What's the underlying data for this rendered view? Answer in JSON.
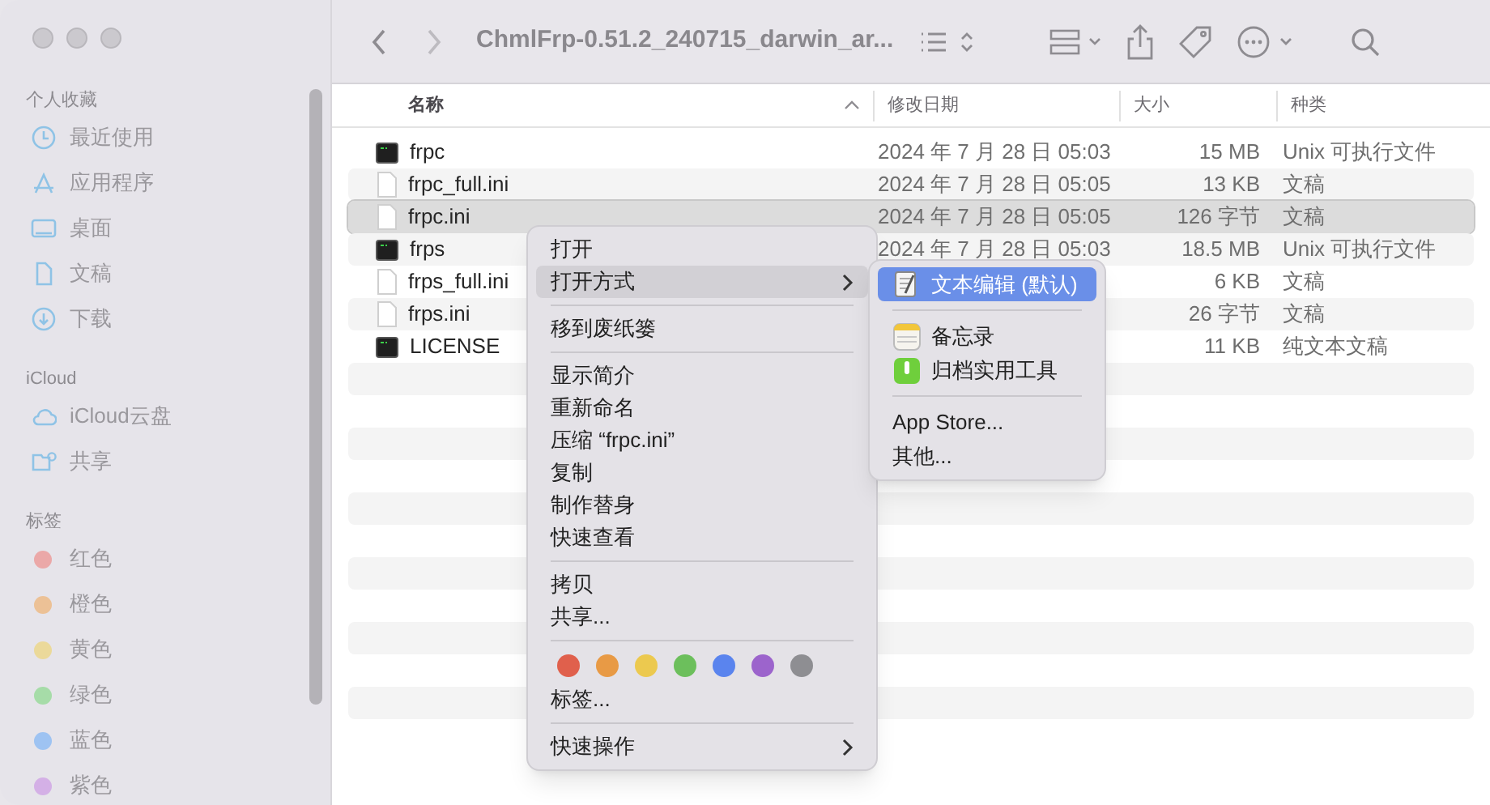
{
  "window": {
    "title": "ChmlFrp-0.51.2_240715_darwin_ar..."
  },
  "sidebar": {
    "sections": [
      {
        "heading": "个人收藏",
        "items": [
          {
            "label": "最近使用",
            "kind": "clock"
          },
          {
            "label": "应用程序",
            "kind": "apps"
          },
          {
            "label": "桌面",
            "kind": "desktop"
          },
          {
            "label": "文稿",
            "kind": "doc"
          },
          {
            "label": "下载",
            "kind": "download"
          }
        ]
      },
      {
        "heading": "iCloud",
        "items": [
          {
            "label": "iCloud云盘",
            "kind": "cloud"
          },
          {
            "label": "共享",
            "kind": "shared"
          }
        ]
      },
      {
        "heading": "标签",
        "items": [
          {
            "label": "红色",
            "color": "#eba8a8"
          },
          {
            "label": "橙色",
            "color": "#ecc196"
          },
          {
            "label": "黄色",
            "color": "#ebd99a"
          },
          {
            "label": "绿色",
            "color": "#a6dca8"
          },
          {
            "label": "蓝色",
            "color": "#9ec3f2"
          },
          {
            "label": "紫色",
            "color": "#d4b0e6"
          }
        ]
      }
    ]
  },
  "table": {
    "columns": [
      "名称",
      "修改日期",
      "大小",
      "种类"
    ],
    "rows": [
      {
        "name": "frpc",
        "kind": "exec",
        "modified": "2024 年 7 月 28 日 05:03",
        "size": "15 MB",
        "type": "Unix 可执行文件",
        "selected": false
      },
      {
        "name": "frpc_full.ini",
        "kind": "doc",
        "modified": "2024 年 7 月 28 日 05:05",
        "size": "13 KB",
        "type": "文稿",
        "selected": false
      },
      {
        "name": "frpc.ini",
        "kind": "doc",
        "modified": "2024 年 7 月 28 日 05:05",
        "size": "126 字节",
        "type": "文稿",
        "selected": true
      },
      {
        "name": "frps",
        "kind": "exec",
        "modified": "2024 年 7 月 28 日 05:03",
        "size": "18.5 MB",
        "type": "Unix 可执行文件",
        "selected": false
      },
      {
        "name": "frps_full.ini",
        "kind": "doc",
        "modified": "",
        "size": "6 KB",
        "type": "文稿",
        "selected": false
      },
      {
        "name": "frps.ini",
        "kind": "doc",
        "modified": "",
        "size": "26 字节",
        "type": "文稿",
        "selected": false
      },
      {
        "name": "LICENSE",
        "kind": "exec",
        "modified": "",
        "size": "11 KB",
        "type": "纯文本文稿",
        "selected": false
      }
    ]
  },
  "context_menu": {
    "groups": [
      [
        {
          "label": "打开",
          "selected": false
        },
        {
          "label": "打开方式",
          "selected": true,
          "submenu": true
        }
      ],
      [
        {
          "label": "移到废纸篓",
          "selected": false
        }
      ],
      [
        {
          "label": "显示简介",
          "selected": false
        },
        {
          "label": "重新命名",
          "selected": false
        },
        {
          "label": "压缩 “frpc.ini”",
          "selected": false
        },
        {
          "label": "复制",
          "selected": false
        },
        {
          "label": "制作替身",
          "selected": false
        },
        {
          "label": "快速查看",
          "selected": false
        }
      ],
      [
        {
          "label": "拷贝",
          "selected": false
        },
        {
          "label": "共享...",
          "selected": false
        }
      ],
      [
        {
          "kind": "tags",
          "colors": [
            {
              "color": "#e0604c"
            },
            {
              "color": "#e89a45"
            },
            {
              "color": "#ecc94f"
            },
            {
              "color": "#6cbf5c"
            },
            {
              "color": "#5a84ee"
            },
            {
              "color": "#9c64cc"
            },
            {
              "color": "#8e8e92"
            }
          ]
        },
        {
          "label": "标签...",
          "selected": false
        }
      ],
      [
        {
          "label": "快速操作",
          "selected": false,
          "submenu": true
        }
      ]
    ]
  },
  "submenu": {
    "groups": [
      [
        {
          "label": "文本编辑 (默认)",
          "kind": "textedit",
          "selected": true
        }
      ],
      [
        {
          "label": "备忘录",
          "kind": "notes",
          "selected": false
        },
        {
          "label": "归档实用工具",
          "kind": "archive",
          "selected": false
        }
      ],
      [
        {
          "label": "App Store...",
          "selected": false
        },
        {
          "label": "其他...",
          "selected": false
        }
      ]
    ]
  }
}
